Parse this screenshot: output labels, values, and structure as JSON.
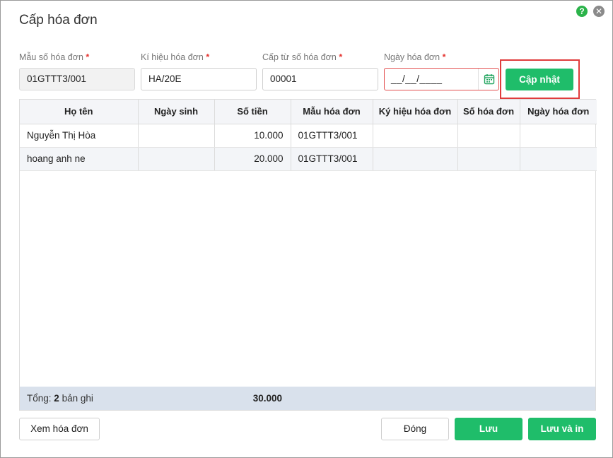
{
  "dialog": {
    "title": "Cấp hóa đơn"
  },
  "fields": {
    "template": {
      "label": "Mẫu số hóa đơn",
      "value": "01GTTT3/001"
    },
    "symbol": {
      "label": "Kí hiệu hóa đơn",
      "value": "HA/20E"
    },
    "from_number": {
      "label": "Cấp từ số hóa đơn",
      "value": "00001"
    },
    "invoice_date": {
      "label": "Ngày hóa đơn",
      "value": "__/__/____"
    },
    "required_mark": "*"
  },
  "buttons": {
    "update": "Cập nhật",
    "view_invoice": "Xem hóa đơn",
    "close": "Đóng",
    "save": "Lưu",
    "save_print": "Lưu và in"
  },
  "table": {
    "columns": [
      "Họ tên",
      "Ngày sinh",
      "Số tiền",
      "Mẫu hóa đơn",
      "Ký hiệu hóa đơn",
      "Số hóa đơn",
      "Ngày hóa đơn"
    ],
    "rows": [
      [
        "Nguyễn Thị Hòa",
        "",
        "10.000",
        "01GTTT3/001",
        "",
        "",
        ""
      ],
      [
        "hoang anh ne",
        "",
        "20.000",
        "01GTTT3/001",
        "",
        "",
        ""
      ]
    ],
    "footer": {
      "label_prefix": "Tổng:",
      "count": "2",
      "label_suffix": "bản ghi",
      "total": "30.000"
    }
  },
  "colors": {
    "accent_green": "#1fbd6a",
    "error_red": "#e35050",
    "help_green": "#2bb34a"
  },
  "icons": {
    "help": "help-icon",
    "close": "close-icon",
    "calendar": "calendar-icon"
  }
}
